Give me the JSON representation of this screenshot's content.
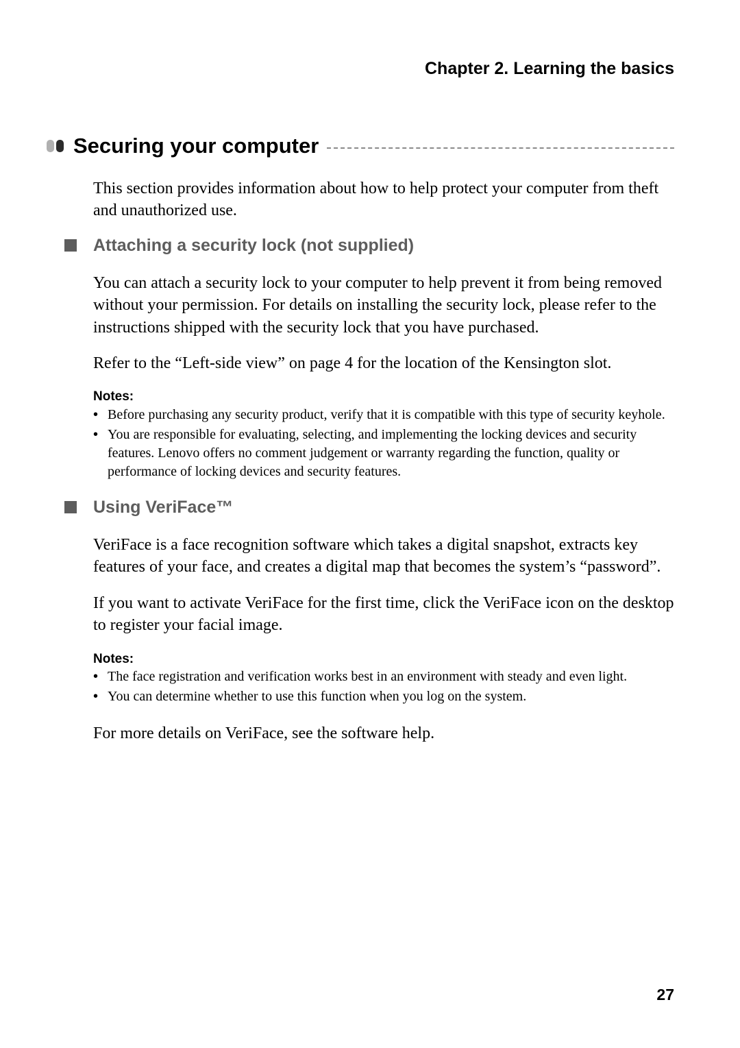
{
  "chapter_header": "Chapter 2. Learning the basics",
  "main_heading": "Securing your computer",
  "intro": "This section provides information about how to help protect your computer from theft and unauthorized use.",
  "section1": {
    "heading": "Attaching a security lock (not supplied)",
    "para1": "You can attach a security lock to your computer to help prevent it from being removed without your permission. For details on installing the security lock, please refer to the instructions shipped with the security lock that you have purchased.",
    "para2": "Refer to the “Left-side view” on page 4 for the location of the Kensington slot.",
    "notes_label": "Notes:",
    "notes": [
      "Before purchasing any security product, verify that it is compatible with this type of security keyhole.",
      "You are responsible for evaluating, selecting, and implementing the locking devices and security features. Lenovo offers no comment judgement or warranty regarding the function, quality or performance of locking devices and security features."
    ]
  },
  "section2": {
    "heading": "Using VeriFace™",
    "para1": "VeriFace is a face recognition software which takes a digital snapshot, extracts key features of your face, and creates a digital map that becomes the system’s “password”.",
    "para2": "If you want to activate VeriFace for the first time, click the VeriFace icon on the desktop to register your facial image.",
    "notes_label": "Notes:",
    "notes": [
      "The face registration and verification works best in an environment with steady and even light.",
      "You can determine whether to use this function when you log on the system."
    ],
    "para3": "For more details on VeriFace, see the software help."
  },
  "page_number": "27"
}
